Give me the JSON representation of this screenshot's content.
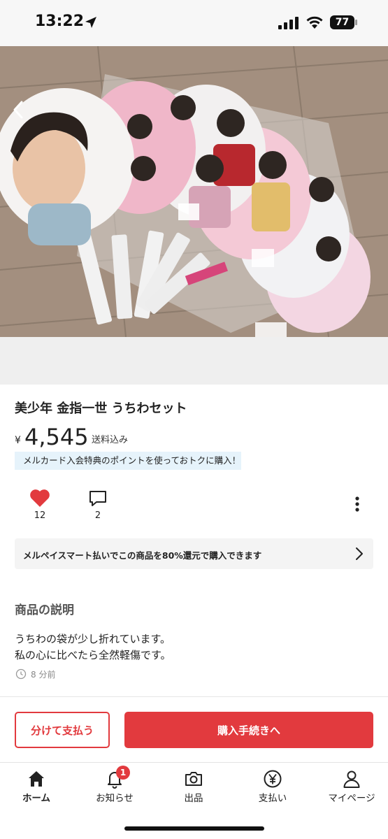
{
  "status_bar": {
    "time": "13:22",
    "battery": "77"
  },
  "product": {
    "title": "美少年 金指一世 うちわセット",
    "price_symbol": "¥",
    "price": "4,545",
    "shipping": "送料込み",
    "promo": "メルカード入会特典のポイントを使っておトクに購入！"
  },
  "actions": {
    "likes": "12",
    "comments": "2"
  },
  "merpay_banner": {
    "text": "メルペイスマート払いでこの商品を80%還元で購入できます"
  },
  "description": {
    "heading": "商品の説明",
    "line1": "うちわの袋が少し折れています。",
    "line2": "私の心に比べたら全然軽傷です。",
    "posted": "8 分前"
  },
  "purchase": {
    "split_label": "分けて支払う",
    "buy_label": "購入手続きへ"
  },
  "tabs": [
    {
      "label": "ホーム",
      "icon": "home-icon"
    },
    {
      "label": "お知らせ",
      "icon": "bell-icon"
    },
    {
      "label": "出品",
      "icon": "camera-icon"
    },
    {
      "label": "支払い",
      "icon": "yen-icon"
    },
    {
      "label": "マイページ",
      "icon": "person-icon"
    }
  ],
  "notification_badge": "1",
  "colors": {
    "accent": "#e23a3e",
    "heart": "#e23a3e",
    "promo_bg": "#e6f3fb"
  }
}
